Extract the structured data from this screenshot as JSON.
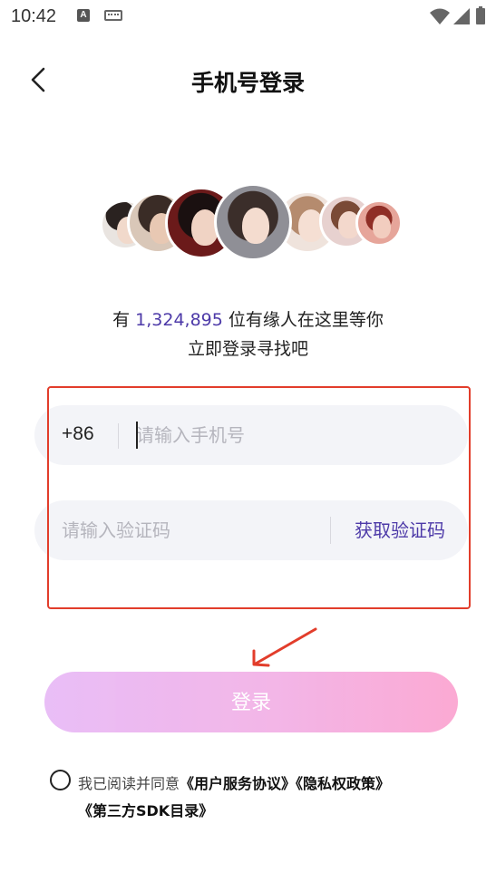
{
  "status_bar": {
    "time": "10:42",
    "notification_letter": "A",
    "icons": [
      "notification-a-icon",
      "keyboard-icon",
      "wifi-icon",
      "signal-icon",
      "battery-icon"
    ]
  },
  "header": {
    "back_icon": "chevron-left-icon",
    "title": "手机号登录"
  },
  "avatars": {
    "count": 7
  },
  "slogan": {
    "prefix": "有 ",
    "count": "1,324,895",
    "suffix": " 位有缘人在这里等你",
    "line2": "立即登录寻找吧"
  },
  "form": {
    "country_code": "+86",
    "phone_placeholder": "请输入手机号",
    "code_placeholder": "请输入验证码",
    "get_code_label": "获取验证码"
  },
  "login": {
    "label": "登录"
  },
  "agreement": {
    "prefix": "我已阅读并同意",
    "user_agreement": "《用户服务协议》",
    "privacy_policy": "《隐私权政策》",
    "sdk_list": "《第三方SDK目录》",
    "checked": false
  },
  "colors": {
    "accent": "#4d3aa8",
    "annotation_red": "#e23d2b",
    "button_gradient_start": "#e7b8f6",
    "button_gradient_end": "#fba2cf",
    "field_bg": "#f3f4f8"
  }
}
